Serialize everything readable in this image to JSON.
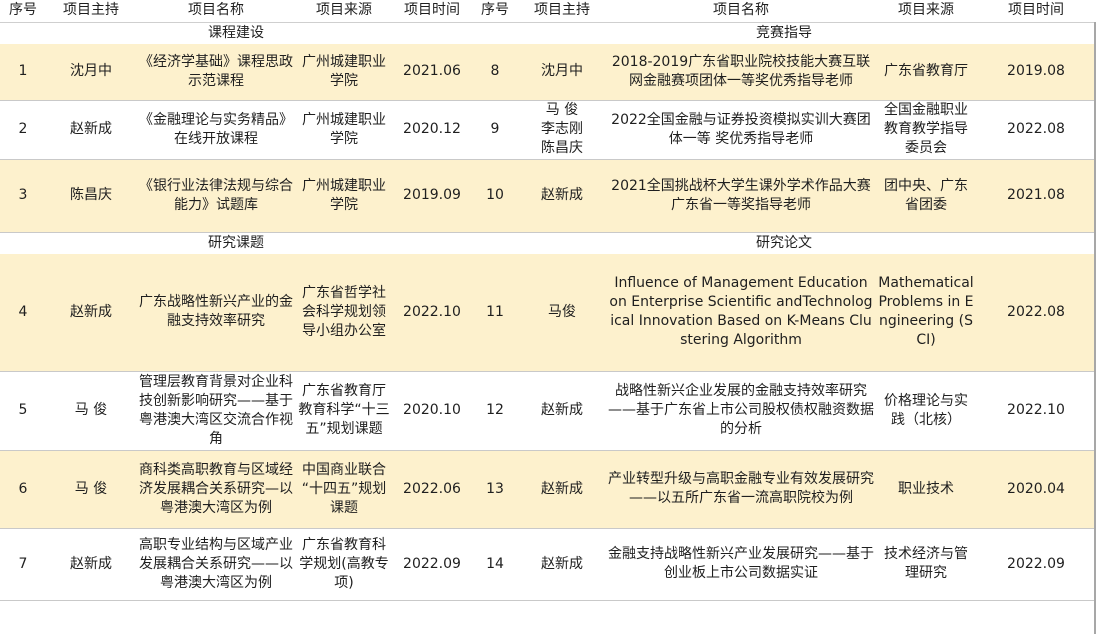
{
  "headers": [
    "序号",
    "项目主持",
    "项目名称",
    "项目来源",
    "项目时间",
    "序号",
    "项目主持",
    "项目名称",
    "项目来源",
    "项目时间"
  ],
  "sections": {
    "left_1": "课程建设",
    "right_1": "竞赛指导",
    "left_2": "研究课题",
    "right_2": "研究论文"
  },
  "rows": [
    {
      "l_no": "1",
      "l_host": "沈月中",
      "l_name": "《经济学基础》课程思政示范课程",
      "l_source": "广州城建职业学院",
      "l_time": "2021.06",
      "r_no": "8",
      "r_host": "沈月中",
      "r_name": "2018-2019广东省职业院校技能大赛互联网金融赛项团体一等奖优秀指导老师",
      "r_source": "广东省教育厅",
      "r_time": "2019.08"
    },
    {
      "l_no": "2",
      "l_host": "赵新成",
      "l_name": "《金融理论与实务精品》在线开放课程",
      "l_source": "广州城建职业学院",
      "l_time": "2020.12",
      "r_no": "9",
      "r_host": "马 俊\n李志刚\n陈昌庆",
      "r_name": "2022全国金融与证券投资模拟实训大赛团体一等 奖优秀指导老师",
      "r_source": "全国金融职业教育教学指导委员会",
      "r_time": "2022.08"
    },
    {
      "l_no": "3",
      "l_host": "陈昌庆",
      "l_name": "《银行业法律法规与综合能力》试题库",
      "l_source": "广州城建职业学院",
      "l_time": "2019.09",
      "r_no": "10",
      "r_host": "赵新成",
      "r_name": "2021全国挑战杯大学生课外学术作品大赛广东省一等奖指导老师",
      "r_source": "团中央、广东省团委",
      "r_time": "2021.08"
    },
    {
      "l_no": "4",
      "l_host": "赵新成",
      "l_name": "广东战略性新兴产业的金融支持效率研究",
      "l_source": "广东省哲学社会科学规划领导小组办公室",
      "l_time": "2022.10",
      "r_no": "11",
      "r_host": "马俊",
      "r_name": "Influence of Management Education on Enterprise Scientific andTechnological Innovation Based on K-Means Clustering Algorithm",
      "r_source": "Mathematical Problems in Engineering (SCI)",
      "r_time": "2022.08"
    },
    {
      "l_no": "5",
      "l_host": "马 俊",
      "l_name": "管理层教育背景对企业科技创新影响研究——基于粤港澳大湾区交流合作视角",
      "l_source": "广东省教育厅教育科学“十三五”规划课题",
      "l_time": "2020.10",
      "r_no": "12",
      "r_host": "赵新成",
      "r_name": "战略性新兴企业发展的金融支持效率研究——基于广东省上市公司股权债权融资数据的分析",
      "r_source": "价格理论与实践（北核）",
      "r_time": "2022.10"
    },
    {
      "l_no": "6",
      "l_host": "马 俊",
      "l_name": "商科类高职教育与区域经济发展耦合关系研究—以粤港澳大湾区为例",
      "l_source": "中国商业联合 “十四五”规划课题",
      "l_time": "2022.06",
      "r_no": "13",
      "r_host": "赵新成",
      "r_name": "产业转型升级与高职金融专业有效发展研究——以五所广东省一流高职院校为例",
      "r_source": "职业技术",
      "r_time": "2020.04"
    },
    {
      "l_no": "7",
      "l_host": "赵新成",
      "l_name": "高职专业结构与区域产业发展耦合关系研究——以粤港澳大湾区为例",
      "l_source": "广东省教育科学规划(高教专项)",
      "l_time": "2022.09",
      "r_no": "14",
      "r_host": "赵新成",
      "r_name": "金融支持战略性新兴产业发展研究——基于创业板上市公司数据实证",
      "r_source": "技术经济与管理研究",
      "r_time": "2022.09"
    }
  ]
}
